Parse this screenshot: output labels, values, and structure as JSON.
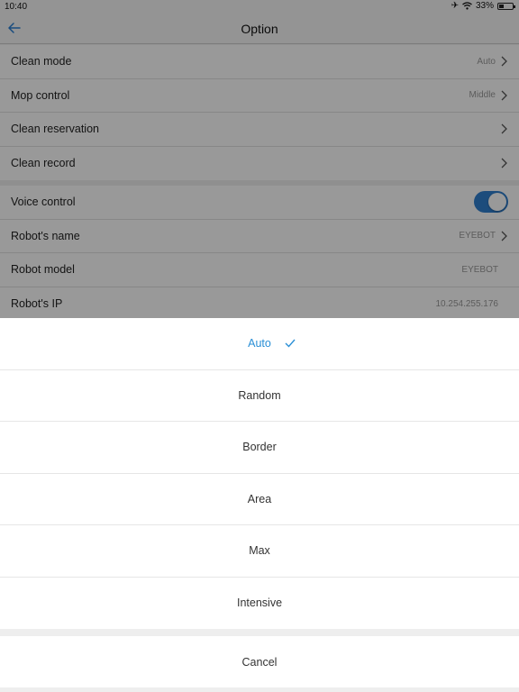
{
  "status": {
    "time": "10:40",
    "battery": "33%"
  },
  "nav": {
    "title": "Option"
  },
  "settings": {
    "group1": [
      {
        "label": "Clean mode",
        "value": "Auto",
        "chevron": true
      },
      {
        "label": "Mop control",
        "value": "Middle",
        "chevron": true
      },
      {
        "label": "Clean reservation",
        "value": "",
        "chevron": true
      },
      {
        "label": "Clean record",
        "value": "",
        "chevron": true
      }
    ],
    "group2": [
      {
        "label": "Voice control",
        "toggle": true
      },
      {
        "label": "Robot's name",
        "value": "EYEBOT",
        "chevron": true
      },
      {
        "label": "Robot model",
        "value": "EYEBOT",
        "chevron": false
      },
      {
        "label": "Robot's IP",
        "value": "10.254.255.176",
        "chevron": false
      }
    ]
  },
  "sheet": {
    "options": [
      "Auto",
      "Random",
      "Border",
      "Area",
      "Max",
      "Intensive"
    ],
    "selected": "Auto",
    "cancel_label": "Cancel"
  },
  "colors": {
    "accent": "#2a8fd6",
    "toggle_on": "#2f7fcf"
  }
}
